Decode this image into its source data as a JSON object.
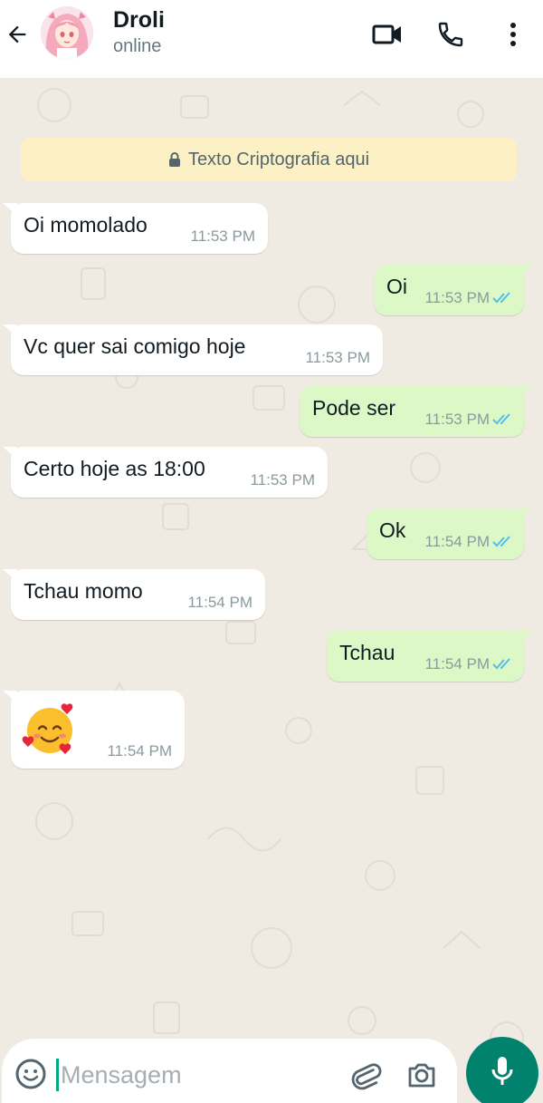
{
  "header": {
    "contact_name": "Droli",
    "status": "online",
    "icons": [
      "back-arrow-icon",
      "video-call-icon",
      "phone-icon",
      "more-vert-icon"
    ]
  },
  "encryption_notice": "Texto Criptografia aqui",
  "messages": [
    {
      "direction": "in",
      "text": "Oi momolado",
      "time": "11:53 PM"
    },
    {
      "direction": "out",
      "text": "Oi",
      "time": "11:53 PM",
      "read": true
    },
    {
      "direction": "in",
      "text": "Vc quer sai comigo hoje",
      "time": "11:53 PM"
    },
    {
      "direction": "out",
      "text": "Pode ser",
      "time": "11:53 PM",
      "read": true
    },
    {
      "direction": "in",
      "text": "Certo hoje as 18:00",
      "time": "11:53 PM"
    },
    {
      "direction": "out",
      "text": "Ok",
      "time": "11:54 PM",
      "read": true
    },
    {
      "direction": "in",
      "text": "Tchau momo",
      "time": "11:54 PM"
    },
    {
      "direction": "out",
      "text": "Tchau",
      "time": "11:54 PM",
      "read": true
    },
    {
      "direction": "in",
      "emoji": "smiling-face-with-hearts",
      "text": "🥰",
      "time": "11:54 PM"
    }
  ],
  "input": {
    "placeholder": "Mensagem"
  },
  "colors": {
    "header_bg": "#ffffff",
    "chat_bg": "#efeae2",
    "incoming_bubble": "#ffffff",
    "outgoing_bubble": "#dcf8c6",
    "encryption_bg": "#fcf1c4",
    "read_ticks": "#53bdeb",
    "mic_button": "#00826e"
  }
}
